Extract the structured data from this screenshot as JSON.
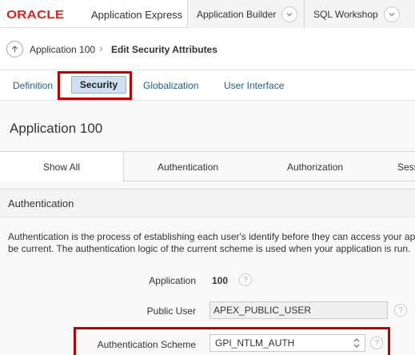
{
  "header": {
    "logo_brand": "ORACLE",
    "logo_product": "Application Express",
    "tabs": [
      {
        "label": "Application Builder"
      },
      {
        "label": "SQL Workshop"
      }
    ]
  },
  "breadcrumb": {
    "app": "Application 100",
    "current": "Edit Security Attributes"
  },
  "subtabs": {
    "items": [
      "Definition",
      "Security",
      "Globalization",
      "User Interface"
    ],
    "selected": "Security"
  },
  "region_title": "Application 100",
  "section_tabs": [
    "Show All",
    "Authentication",
    "Authorization",
    "Sess"
  ],
  "auth_section": {
    "title": "Authentication",
    "description_line1": "Authentication is the process of establishing each user's identify before they can access your app",
    "description_line2": "be current. The authentication logic of the current scheme is used when your application is run.",
    "fields": {
      "application_label": "Application",
      "application_value": "100",
      "public_user_label": "Public User",
      "public_user_value": "APEX_PUBLIC_USER",
      "auth_scheme_label": "Authentication Scheme",
      "auth_scheme_value": "GPI_NTLM_AUTH"
    },
    "help_glyph": "?"
  },
  "colors": {
    "brand_red": "#e2231a",
    "highlight": "#c00000",
    "link_blue": "#1a5e9a",
    "selected_tab_bg": "#cfe0f2"
  },
  "icons": [
    "chevron-down-icon",
    "arrow-up-icon",
    "chevron-right-icon",
    "help-icon",
    "select-arrows-icon"
  ]
}
